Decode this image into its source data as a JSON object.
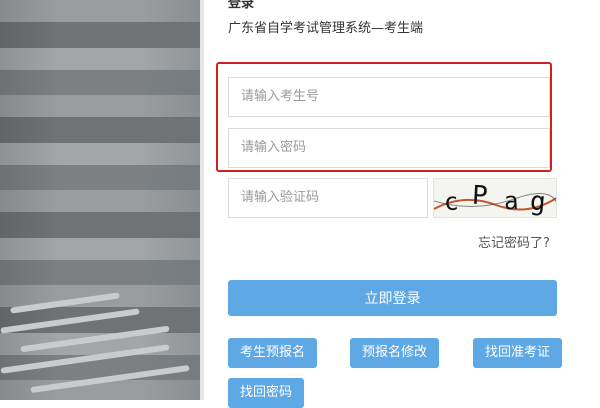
{
  "header": {
    "title_fragment": "登录",
    "subtitle": "广东省自学考试管理系统—考生端"
  },
  "form": {
    "candidate_number_placeholder": "请输入考生号",
    "password_placeholder": "请输入密码",
    "captcha_placeholder": "请输入验证码",
    "captcha_text": "cPag",
    "forgot_password": "忘记密码了?",
    "login_button": "立即登录"
  },
  "actions": {
    "pre_register": "考生预报名",
    "modify_pre_register": "预报名修改",
    "retrieve_admission_ticket": "找回准考证",
    "retrieve_password": "找回密码"
  },
  "colors": {
    "primary_button": "#5fa8e6",
    "highlight_border": "#cc2222"
  }
}
